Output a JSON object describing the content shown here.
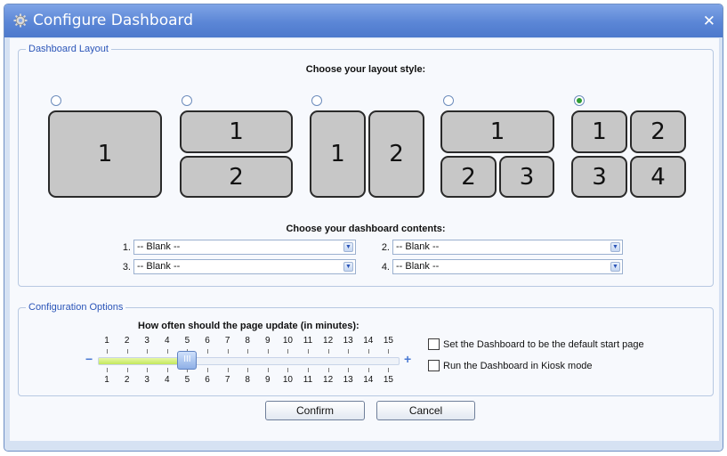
{
  "window": {
    "title": "Configure Dashboard",
    "close_glyph": "✕",
    "title_icon": "gear-icon"
  },
  "layout_section": {
    "legend": "Dashboard Layout",
    "prompt": "Choose your layout style:",
    "options": [
      {
        "id": "single",
        "selected": false,
        "cells": [
          "1"
        ]
      },
      {
        "id": "two-rows",
        "selected": false,
        "cells": [
          "1",
          "2"
        ]
      },
      {
        "id": "two-columns",
        "selected": false,
        "cells": [
          "1",
          "2"
        ]
      },
      {
        "id": "one-top-two-bottom",
        "selected": false,
        "cells": [
          "1",
          "2",
          "3"
        ]
      },
      {
        "id": "grid-2x2",
        "selected": true,
        "cells": [
          "1",
          "2",
          "3",
          "4"
        ]
      }
    ],
    "contents_prompt": "Choose your dashboard contents:",
    "slots": [
      {
        "label": "1.",
        "value": "-- Blank --"
      },
      {
        "label": "2.",
        "value": "-- Blank --"
      },
      {
        "label": "3.",
        "value": "-- Blank --"
      },
      {
        "label": "4.",
        "value": "-- Blank --"
      }
    ]
  },
  "options_section": {
    "legend": "Configuration Options",
    "slider_title": "How often should the page update (in minutes):",
    "ticks": [
      "1",
      "2",
      "3",
      "4",
      "5",
      "6",
      "7",
      "8",
      "9",
      "10",
      "11",
      "12",
      "13",
      "14",
      "15"
    ],
    "slider_value": 5,
    "minus": "−",
    "plus": "+",
    "thumb_glyph": "III",
    "checkboxes": [
      {
        "label": "Set the Dashboard to be the default start page",
        "checked": false
      },
      {
        "label": "Run the Dashboard in Kiosk mode",
        "checked": false
      }
    ]
  },
  "buttons": {
    "confirm": "Confirm",
    "cancel": "Cancel"
  },
  "colors": {
    "title_bar": "#5b86d6",
    "legend_text": "#2b55b8",
    "cell_fill": "#c7c7c7",
    "slider_fill": "#c4e85c",
    "radio_selected": "#2e9c34"
  }
}
